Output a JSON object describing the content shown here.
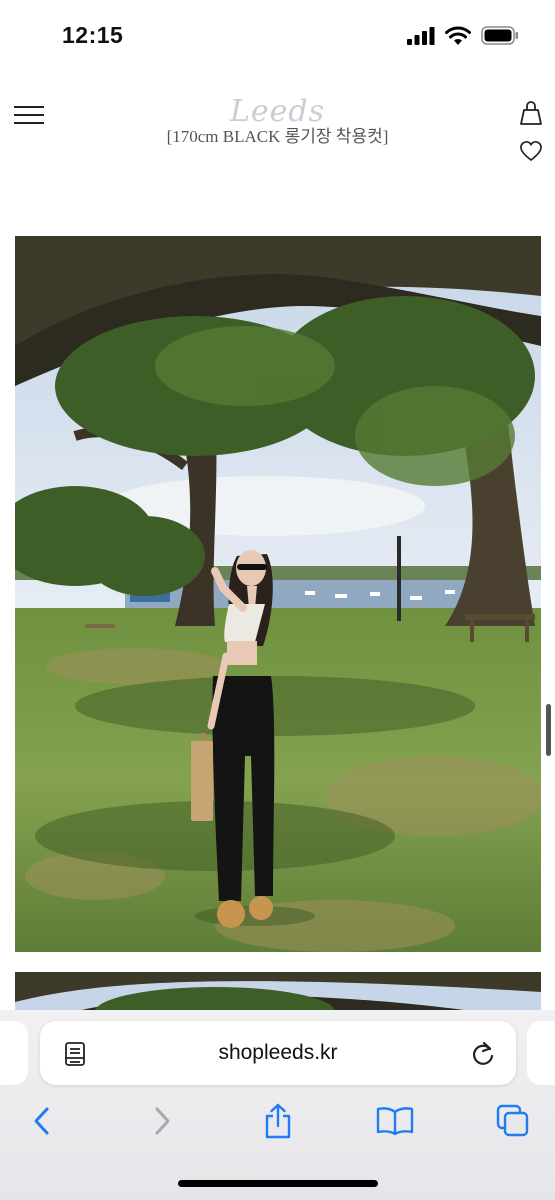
{
  "status_bar": {
    "time": "12:15"
  },
  "header": {
    "logo_text": "Leeds",
    "page_title": "[170cm BLACK 롱기장 착용컷]"
  },
  "browser": {
    "url": "shopleeds.kr"
  },
  "icons": {
    "menu": "hamburger-icon",
    "cart": "shopping-bag-icon",
    "wishlist": "heart-icon",
    "reader": "reader-mode-icon",
    "reload": "reload-icon",
    "back": "chevron-left-icon",
    "forward": "chevron-right-icon",
    "share": "share-icon",
    "bookmarks": "book-icon",
    "tabs": "tabs-icon"
  },
  "colors": {
    "safari_blue": "#1f7cf2",
    "disabled_gray": "#a8a8ad"
  }
}
